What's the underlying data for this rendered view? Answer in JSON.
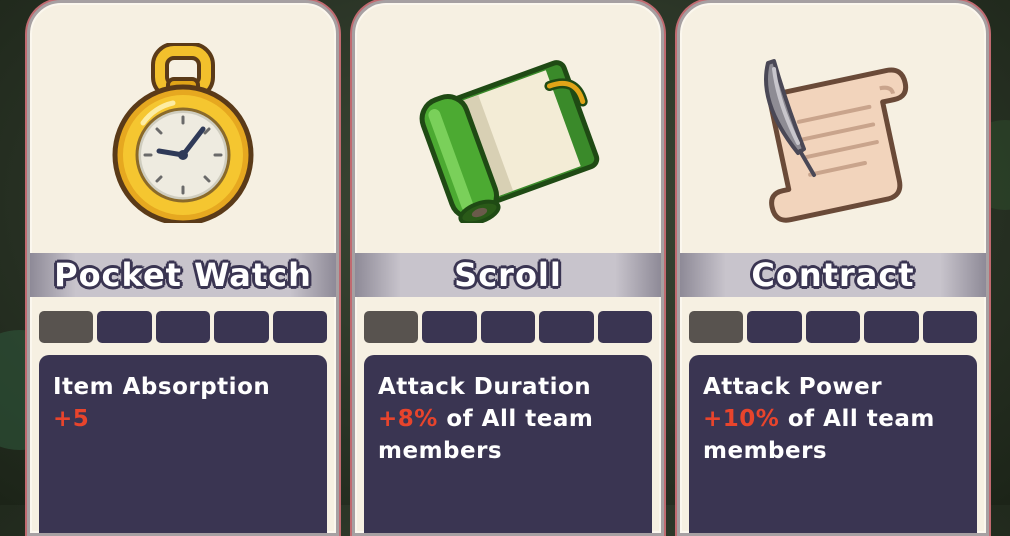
{
  "cards": [
    {
      "title": "Pocket Watch",
      "icon": "pocket-watch-icon",
      "level_filled": 1,
      "level_total": 5,
      "stat": "Item Absorption",
      "bonus": "+5",
      "suffix": ""
    },
    {
      "title": "Scroll",
      "icon": "scroll-icon",
      "level_filled": 1,
      "level_total": 5,
      "stat": "Attack Duration",
      "bonus": "+8%",
      "suffix": " of All team members"
    },
    {
      "title": "Contract",
      "icon": "contract-icon",
      "level_filled": 1,
      "level_total": 5,
      "stat": "Attack Power",
      "bonus": "+10%",
      "suffix": " of All team members"
    }
  ],
  "colors": {
    "card_bg": "#f6f0e2",
    "panel": "#3a3552",
    "bonus": "#e8442c"
  }
}
